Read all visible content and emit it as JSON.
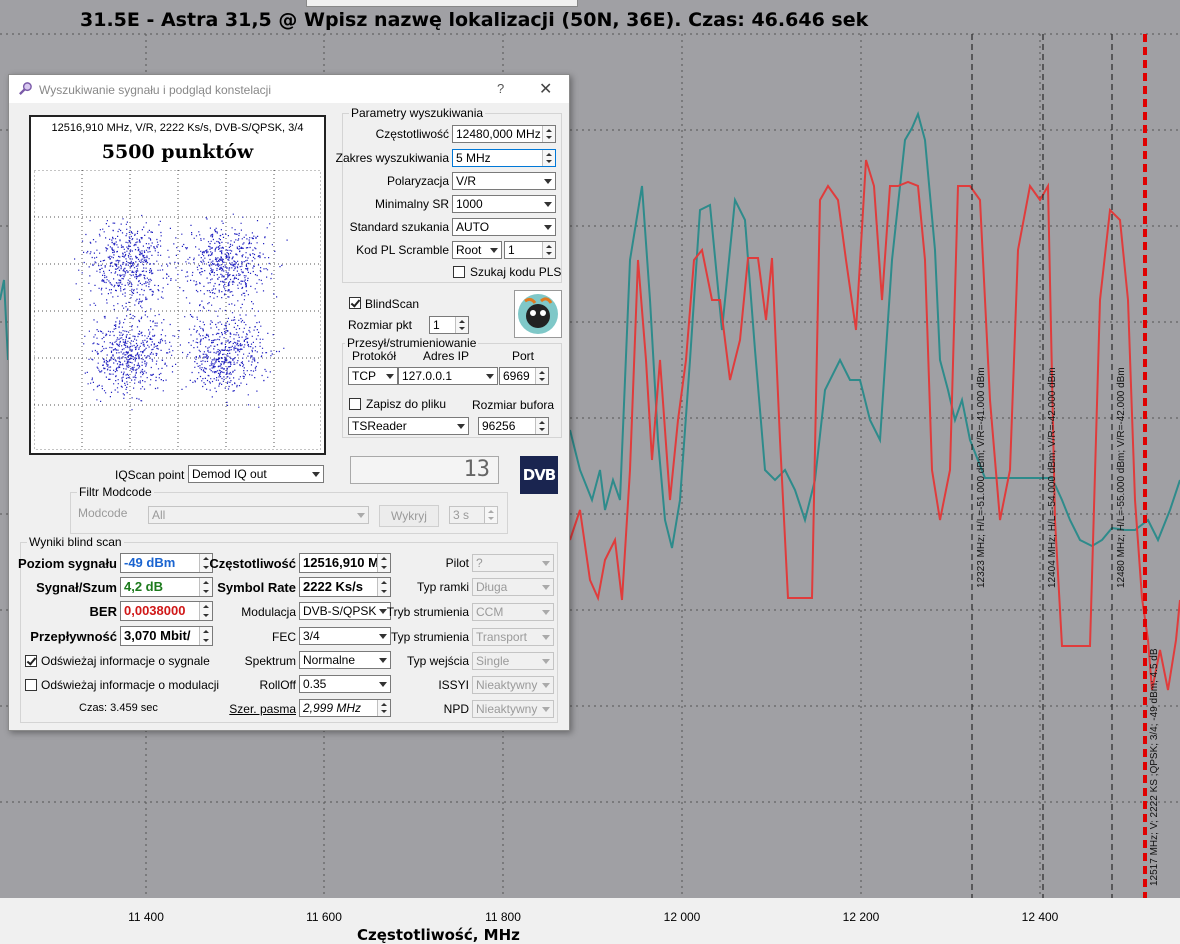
{
  "header": {
    "title": "31.5E - Astra 31,5 @ Wpisz nazwę lokalizacji (50N, 36E). Czas: 46.646 sek"
  },
  "spectrum": {
    "x_axis_label": "Częstotliwość, MHz",
    "x_ticks": [
      "11 400",
      "11 600",
      "11 800",
      "12 000",
      "12 200",
      "12 400"
    ],
    "marker_labels": [
      "12323 MHz;  H/L=-51.000 dBm;  V/R=-41.000 dBm",
      "12404 MHz;  H/L=-54.000 dBm;  V/R=-42.000 dBm",
      "12480 MHz;  H/L=-55.000 dBm;  V/R=-42.000 dBm",
      "12517 MHz; V; 2222 KS ;QPSK; 3/4; -49 dBm; 4.5 dB"
    ],
    "colors": {
      "horizontal": "#2e8b8b",
      "vertical": "#e03c3c",
      "marker": "#e00000"
    }
  },
  "dialog": {
    "title": "Wyszukiwanie sygnału i podgląd konstelacji",
    "help": "?",
    "close": "✕",
    "constellation": {
      "info": "12516,910 MHz, V/R, 2222 Ks/s, DVB-S/QPSK, 3/4",
      "points": "5500 punktów"
    },
    "search_params": {
      "group_title": "Parametry wyszukiwania",
      "frequency_label": "Częstotliwość",
      "frequency_value": "12480,000 MHz",
      "range_label": "Zakres wyszukiwania",
      "range_value": "5 MHz",
      "polarization_label": "Polaryzacja",
      "polarization_value": "V/R",
      "min_sr_label": "Minimalny SR",
      "min_sr_value": "1000",
      "standard_label": "Standard szukania",
      "standard_value": "AUTO",
      "pl_label": "Kod PL Scramble",
      "pl_mode": "Root",
      "pl_value": "1",
      "pls_label": "Szukaj kodu PLS"
    },
    "blindscan_label": "BlindScan",
    "packet_size_label": "Rozmiar pkt",
    "packet_size_value": "1",
    "stream": {
      "group_title": "Przesył/strumieniowanie",
      "protocol_label": "Protokół",
      "ip_label": "Adres IP",
      "port_label": "Port",
      "protocol_value": "TCP",
      "ip_value": "127.0.0.1",
      "port_value": "6969",
      "save_label": "Zapisz do pliku",
      "buffer_label": "Rozmiar bufora",
      "reader_value": "TSReader",
      "buffer_value": "96256"
    },
    "lcd_value": "13",
    "dvb_logo": "DVB",
    "iqscan_label": "IQScan point",
    "iqscan_value": "Demod IQ out",
    "modcode": {
      "group_title": "Filtr Modcode",
      "label": "Modcode",
      "value": "All",
      "detect_button": "Wykryj",
      "time_value": "3 s"
    },
    "results": {
      "group_title": "Wyniki blind scan",
      "signal_level_label": "Poziom sygnału",
      "signal_level_value": "-49 dBm",
      "snr_label": "Sygnał/Szum",
      "snr_value": "4,2 dB",
      "ber_label": "BER",
      "ber_value": "0,0038000",
      "bitrate_label": "Przepływność",
      "bitrate_value": "3,070 Mbit/",
      "refresh_signal_label": "Odświeżaj informacje o sygnale",
      "refresh_mod_label": "Odświeżaj informacje o modulacji",
      "time_label": "Czas: 3.459 sec",
      "freq_label": "Częstotliwość",
      "freq_value": "12516,910 M",
      "sr_label": "Symbol Rate",
      "sr_value": "2222 Ks/s",
      "modulation_label": "Modulacja",
      "modulation_value": "DVB-S/QPSK",
      "fec_label": "FEC",
      "fec_value": "3/4",
      "spectrum_label": "Spektrum",
      "spectrum_value": "Normalne",
      "rolloff_label": "RollOff",
      "rolloff_value": "0.35",
      "bandwidth_label": "Szer. pasma",
      "bandwidth_value": "2,999 MHz",
      "pilot_label": "Pilot",
      "pilot_value": "?",
      "frame_label": "Typ ramki",
      "frame_value": "Długa",
      "stream_type_label1": "Tryb strumienia",
      "stream_type_value1": "CCM",
      "stream_type_label2": "Typ strumienia",
      "stream_type_value2": "Transport",
      "input_label": "Typ wejścia",
      "input_value": "Single",
      "issyi_label": "ISSYI",
      "issyi_value": "Nieaktywny",
      "npd_label": "NPD",
      "npd_value": "Nieaktywny"
    }
  }
}
